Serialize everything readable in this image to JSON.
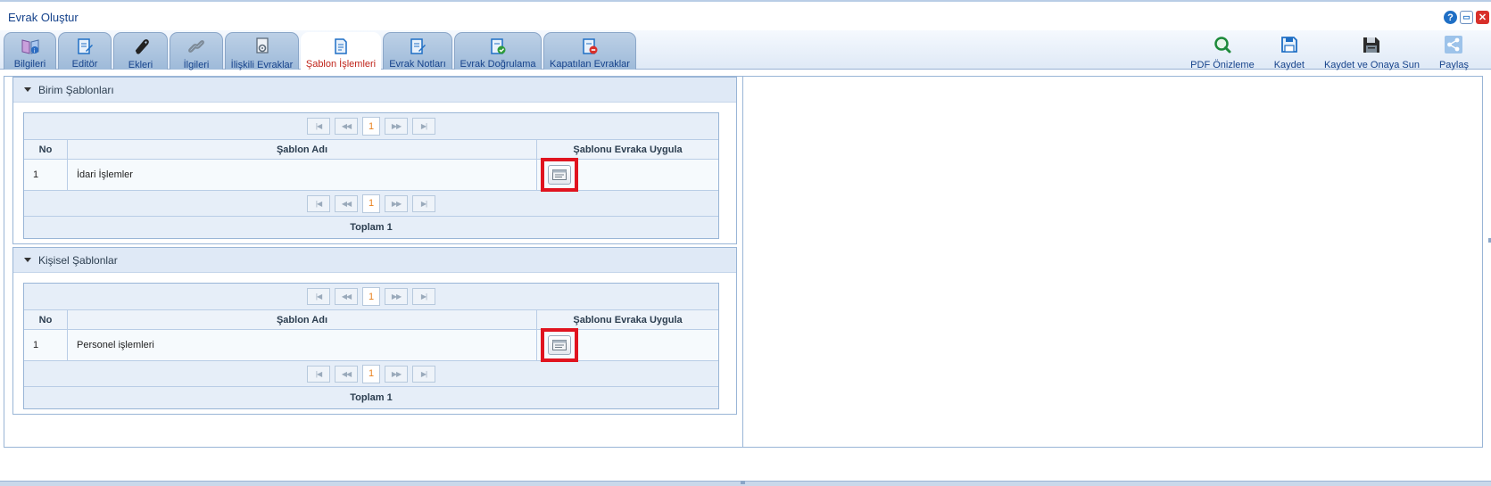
{
  "window": {
    "title": "Evrak Oluştur",
    "controls": [
      {
        "name": "help-icon",
        "glyph": "?"
      },
      {
        "name": "maximize-icon",
        "glyph": "▭"
      },
      {
        "name": "close-icon",
        "glyph": "✕"
      }
    ]
  },
  "tabs": [
    {
      "label": "Bilgileri",
      "icon": "book-info-icon",
      "active": false
    },
    {
      "label": "Editör",
      "icon": "document-edit-icon",
      "active": false
    },
    {
      "label": "Ekleri",
      "icon": "paperclip-icon",
      "active": false
    },
    {
      "label": "İlgileri",
      "icon": "link-icon",
      "active": false
    },
    {
      "label": "İlişkili Evraklar",
      "icon": "related-documents-icon",
      "active": false
    },
    {
      "label": "Şablon İşlemleri",
      "icon": "template-document-icon",
      "active": true
    },
    {
      "label": "Evrak Notları",
      "icon": "document-notes-icon",
      "active": false
    },
    {
      "label": "Evrak Doğrulama",
      "icon": "document-verify-icon",
      "active": false
    },
    {
      "label": "Kapatılan Evraklar",
      "icon": "document-closed-icon",
      "active": false
    }
  ],
  "actions": [
    {
      "label": "PDF Önizleme",
      "icon": "pdf-preview-icon"
    },
    {
      "label": "Kaydet",
      "icon": "save-icon"
    },
    {
      "label": "Kaydet ve Onaya Sun",
      "icon": "save-submit-icon"
    },
    {
      "label": "Paylaş",
      "icon": "share-icon"
    }
  ],
  "sections": [
    {
      "title": "Birim Şablonları",
      "pager": {
        "page": "1"
      },
      "columns": {
        "no": "No",
        "name": "Şablon Adı",
        "apply": "Şablonu Evraka Uygula"
      },
      "rows": [
        {
          "no": "1",
          "name": "İdari İşlemler"
        }
      ],
      "footer": "Toplam 1"
    },
    {
      "title": "Kişisel Şablonlar",
      "pager": {
        "page": "1"
      },
      "columns": {
        "no": "No",
        "name": "Şablon Adı",
        "apply": "Şablonu Evraka Uygula"
      },
      "rows": [
        {
          "no": "1",
          "name": "Personel işlemleri"
        }
      ],
      "footer": "Toplam 1"
    }
  ],
  "colors": {
    "accent": "#15428b",
    "active_tab_text": "#c0251b",
    "highlight": "#e0141f",
    "page_number": "#e8801c"
  }
}
